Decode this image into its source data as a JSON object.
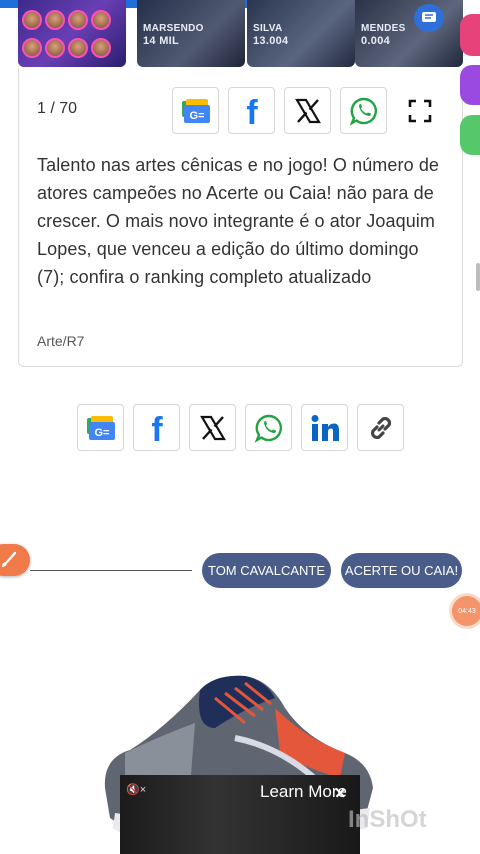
{
  "gallery": {
    "thumbnails": [
      {
        "caption_top": "",
        "caption_bottom": ""
      },
      {
        "caption_top": "MARSENDO",
        "caption_bottom": "14 MIL"
      },
      {
        "caption_top": "SILVA",
        "caption_bottom": "13.004"
      },
      {
        "caption_top": "MENDES",
        "caption_bottom": "0.004"
      }
    ],
    "counter": "1 / 70",
    "caption": "Talento nas artes cênicas e no jogo! O número de atores campeões no Acerte ou Caia! não para de crescer. O mais novo integrante é o ator Joaquim Lopes, que venceu a edição do último domingo (7); confira o ranking completo atualizado",
    "credit": "Arte/R7",
    "share_buttons": [
      "google-news-icon",
      "facebook-icon",
      "x-icon",
      "whatsapp-icon"
    ],
    "fullscreen_icon": "fullscreen-icon"
  },
  "share_bar": {
    "buttons": [
      "google-news-icon",
      "facebook-icon",
      "x-icon",
      "whatsapp-icon",
      "linkedin-icon",
      "link-icon"
    ]
  },
  "tags": [
    "TOM CAVALCANTE",
    "ACERTE OU CAIA!"
  ],
  "recorder": {
    "time": "04:43"
  },
  "video_ad": {
    "learn_more": "Learn More",
    "close": "×",
    "mute": "🔇×"
  },
  "watermark": "InShOt",
  "colors": {
    "accent_blue": "#1e6fd9",
    "tag_bg": "#4a5d8a",
    "facebook": "#1877f2",
    "whatsapp": "#25a244",
    "linkedin": "#0a66c2"
  }
}
